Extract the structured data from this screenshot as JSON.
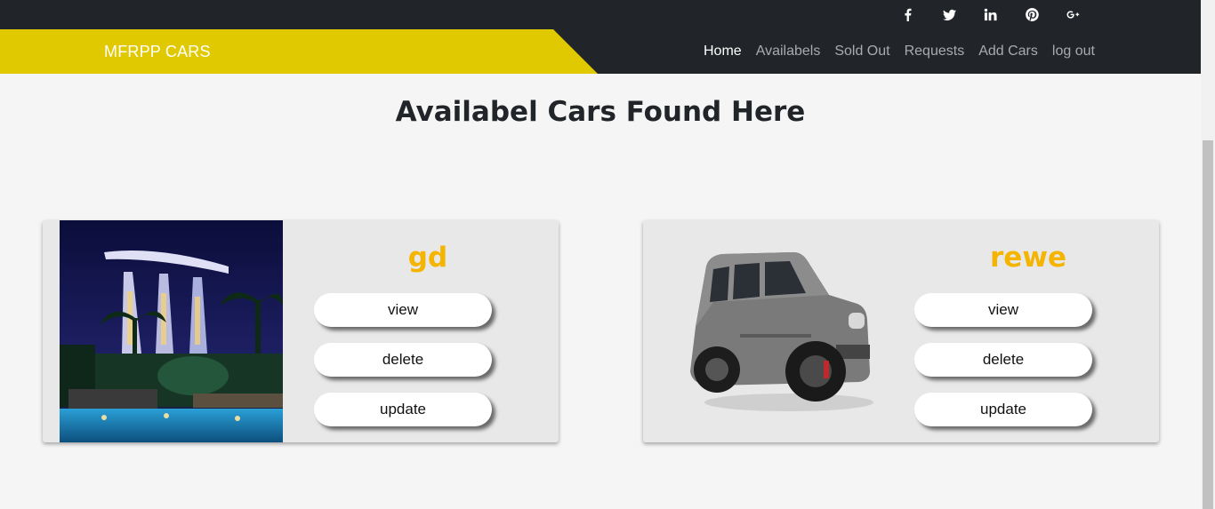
{
  "colors": {
    "topbar_bg": "#212428",
    "accent_yellow": "#e0c900",
    "car_name": "#f4b400",
    "page_bg": "#f5f5f5",
    "card_bg": "#e8e8e8"
  },
  "social": [
    {
      "icon": "facebook-icon"
    },
    {
      "icon": "twitter-icon"
    },
    {
      "icon": "linkedin-icon"
    },
    {
      "icon": "pinterest-icon"
    },
    {
      "icon": "google-plus-icon"
    }
  ],
  "brand": "MFRPP CARS",
  "nav": [
    {
      "label": "Home",
      "active": true
    },
    {
      "label": "Availabels"
    },
    {
      "label": "Sold Out"
    },
    {
      "label": "Requests"
    },
    {
      "label": "Add Cars"
    },
    {
      "label": "log out"
    }
  ],
  "page_title": "Availabel Cars Found Here",
  "cars": [
    {
      "name": "gd",
      "image": "hotel-pool-night-photo",
      "buttons": {
        "view": "view",
        "delete": "delete",
        "update": "update"
      }
    },
    {
      "name": "rewe",
      "image": "grey-suv-photo",
      "buttons": {
        "view": "view",
        "delete": "delete",
        "update": "update"
      }
    }
  ]
}
